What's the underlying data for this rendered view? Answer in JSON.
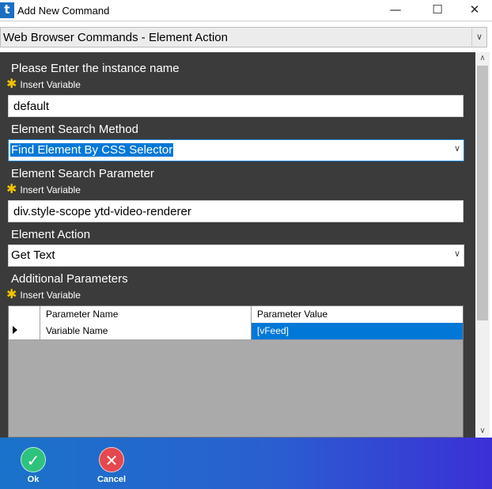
{
  "window": {
    "app_icon": "t",
    "title": "Add New Command",
    "minimize": "—",
    "maximize": "☐",
    "close": "✕"
  },
  "command_select": {
    "value": "Web Browser Commands - Element Action",
    "arrow_icon": "chevron-down-icon"
  },
  "form": {
    "instance": {
      "label": "Please Enter the instance name",
      "insert_variable": "Insert Variable",
      "value": "default"
    },
    "search_method": {
      "label": "Element Search Method",
      "value": "Find Element By CSS Selector"
    },
    "search_parameter": {
      "label": "Element Search Parameter",
      "insert_variable": "Insert Variable",
      "value": "div.style-scope ytd-video-renderer"
    },
    "element_action": {
      "label": "Element Action",
      "value": "Get Text"
    },
    "additional_parameters": {
      "label": "Additional Parameters",
      "insert_variable": "Insert Variable",
      "columns": [
        "Parameter Name",
        "Parameter Value"
      ],
      "rows": [
        {
          "name": "Variable Name",
          "value": "[vFeed]"
        }
      ]
    }
  },
  "actions": {
    "ok": {
      "icon": "checkmark-icon",
      "glyph": "✓",
      "label": "Ok"
    },
    "cancel": {
      "icon": "x-icon",
      "glyph": "✕",
      "label": "Cancel"
    }
  },
  "colors": {
    "panel": "#3b3b3b",
    "selection": "#0078d7",
    "ok": "#2ec27e",
    "cancel": "#e5484d"
  }
}
